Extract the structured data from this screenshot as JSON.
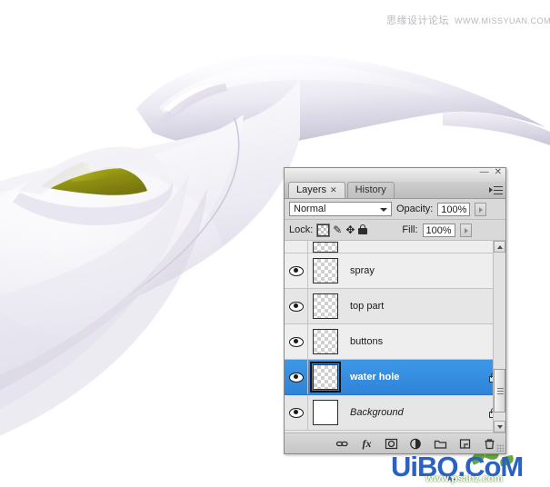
{
  "artwork": {
    "description": "white-glossy-appliance-render",
    "body_color": "#e9e7ef",
    "highlight_color": "#ffffff",
    "shadow_color": "#c9c6d4",
    "water_hole_color": "#9a9a15",
    "water_hole_highlight": "#c9c92a",
    "background_color": "#ffffff"
  },
  "watermark_top": {
    "chinese": "思缘设计论坛",
    "url": "WWW.MISSYUAN.COM"
  },
  "watermark_bottom": {
    "brand": "UiBQ.CoM",
    "url": "www.psahz.com"
  },
  "panel": {
    "window_controls": {
      "minimize": "—",
      "close": "✕"
    },
    "flyout_menu_name": "panel-menu",
    "tabs": [
      {
        "label": "Layers",
        "active": true,
        "closable": true,
        "close_glyph": "✕"
      },
      {
        "label": "History",
        "active": false,
        "closable": false,
        "close_glyph": ""
      }
    ],
    "blend": {
      "mode": "Normal",
      "opacity_label": "Opacity:",
      "opacity_value": "100%"
    },
    "lock": {
      "label": "Lock:",
      "fill_label": "Fill:",
      "fill_value": "100%",
      "buttons": [
        {
          "name": "lock-transparent-pixels",
          "glyph": ""
        },
        {
          "name": "lock-image-pixels",
          "glyph": "✎"
        },
        {
          "name": "lock-position",
          "glyph": "✥"
        },
        {
          "name": "lock-all",
          "glyph": "🔒"
        }
      ]
    },
    "layers": [
      {
        "name": "",
        "visible": false,
        "selected": false,
        "locked": false,
        "thumb": "transparent",
        "clipped": true,
        "italic": false
      },
      {
        "name": "spray",
        "visible": true,
        "selected": false,
        "locked": false,
        "thumb": "transparent",
        "clipped": false,
        "italic": false
      },
      {
        "name": "top part",
        "visible": true,
        "selected": false,
        "locked": false,
        "thumb": "transparent",
        "clipped": false,
        "italic": false
      },
      {
        "name": "buttons",
        "visible": true,
        "selected": false,
        "locked": false,
        "thumb": "transparent",
        "clipped": false,
        "italic": false
      },
      {
        "name": "water hole",
        "visible": true,
        "selected": true,
        "locked": true,
        "thumb": "transparent",
        "clipped": false,
        "italic": false
      },
      {
        "name": "Background",
        "visible": true,
        "selected": false,
        "locked": true,
        "thumb": "white",
        "clipped": false,
        "italic": true
      }
    ],
    "scrollbar": {
      "up_arrow": "▲",
      "down_arrow": "▼",
      "thumb_position": "near-bottom"
    },
    "bottom_toolbar": [
      {
        "name": "link-layers-button",
        "glyph": "⛓"
      },
      {
        "name": "add-layer-style-button",
        "glyph": "fx"
      },
      {
        "name": "add-layer-mask-button",
        "glyph": "◻"
      },
      {
        "name": "new-fill-adjustment-layer-button",
        "glyph": "◐"
      },
      {
        "name": "new-group-button",
        "glyph": "▭"
      },
      {
        "name": "new-layer-button",
        "glyph": "❐"
      },
      {
        "name": "delete-layer-button",
        "glyph": "🗑"
      }
    ],
    "selection_color": "#3d97e8"
  }
}
